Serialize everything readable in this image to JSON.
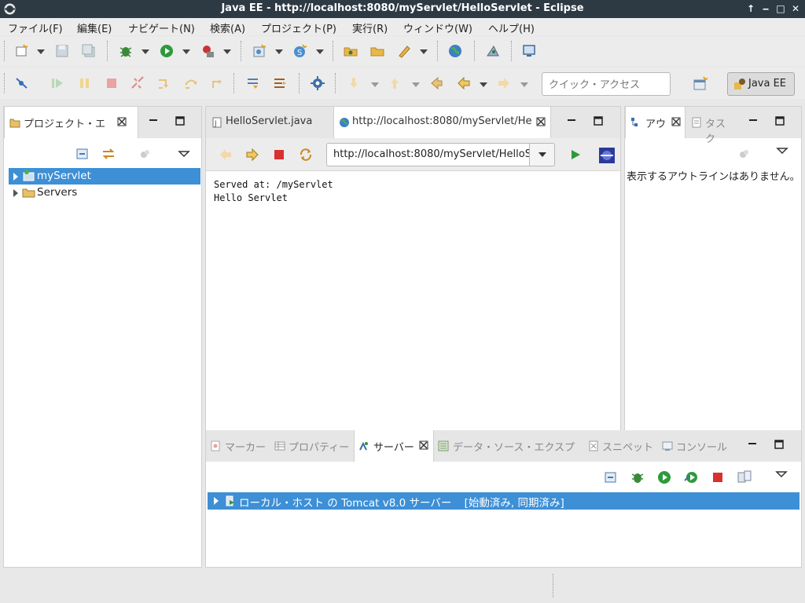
{
  "window": {
    "title": "Java EE - http://localhost:8080/myServlet/HelloServlet - Eclipse"
  },
  "menu": [
    "ファイル(F)",
    "編集(E)",
    "ナビゲート(N)",
    "検索(A)",
    "プロジェクト(P)",
    "実行(R)",
    "ウィンドウ(W)",
    "ヘルプ(H)"
  ],
  "quick_access": {
    "placeholder": "クイック・アクセス"
  },
  "perspective": {
    "label": "Java EE"
  },
  "project_explorer": {
    "tab_label": "プロジェクト・エ",
    "items": [
      {
        "label": "myServlet",
        "selected": true
      },
      {
        "label": "Servers",
        "selected": false
      }
    ]
  },
  "editor": {
    "tabs": [
      {
        "label": "HelloServlet.java",
        "active": false
      },
      {
        "label": "http://localhost:8080/myServlet/He",
        "active": true
      }
    ],
    "url": "http://localhost:8080/myServlet/HelloServlet",
    "content": [
      "Served at: /myServlet",
      "Hello Servlet"
    ]
  },
  "outline": {
    "tabs": [
      {
        "label": "アウ",
        "active": true
      },
      {
        "label": "タスク",
        "active": false
      }
    ],
    "message": "表示するアウトラインはありません。"
  },
  "bottom": {
    "tabs": [
      {
        "label": "マーカー",
        "active": false
      },
      {
        "label": "プロパティー",
        "active": false
      },
      {
        "label": "サーバー",
        "active": true
      },
      {
        "label": "データ・ソース・エクスプ",
        "active": false
      },
      {
        "label": "スニペット",
        "active": false
      },
      {
        "label": "コンソール",
        "active": false
      }
    ],
    "server_row": {
      "label": "ローカル・ホスト の Tomcat v8.0 サーバー",
      "status": "[始動済み, 同期済み]"
    }
  },
  "colors": {
    "selection": "#3d8fd6",
    "titlebar": "#2d3a44"
  }
}
